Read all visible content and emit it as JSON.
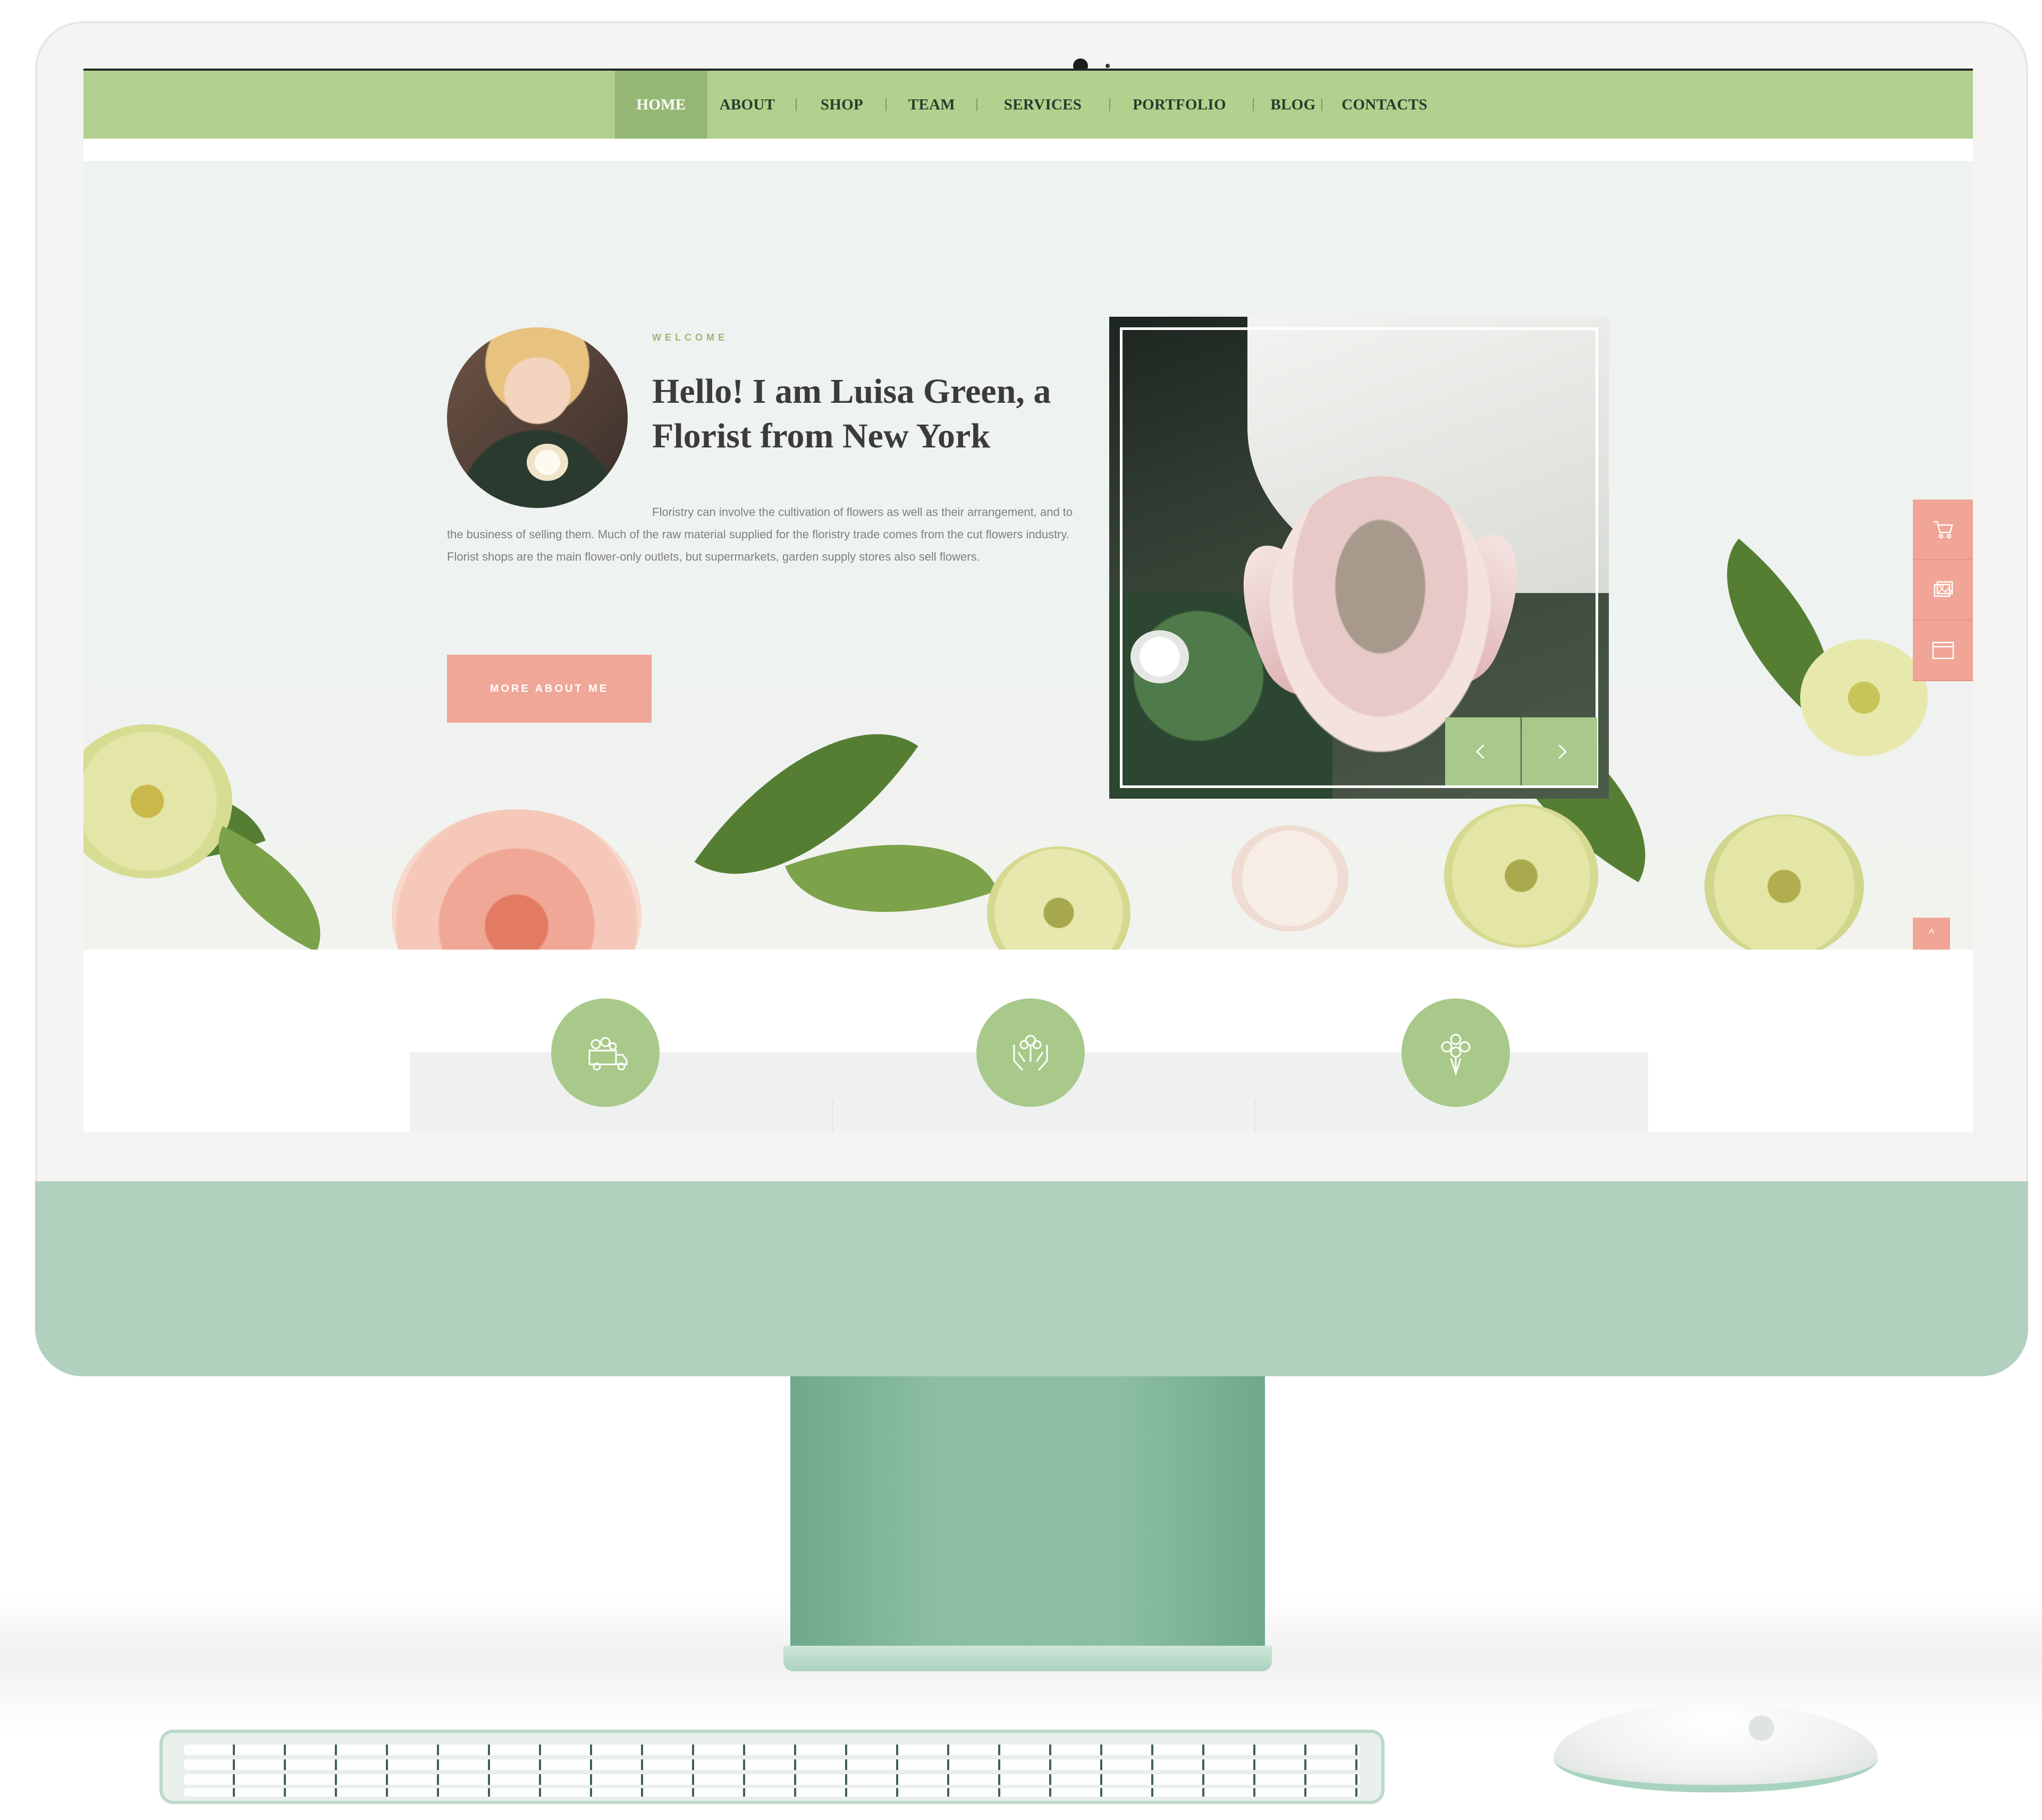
{
  "nav": {
    "items": [
      {
        "label": "HOME",
        "active": true
      },
      {
        "label": "ABOUT",
        "active": false
      },
      {
        "label": "SHOP",
        "active": false
      },
      {
        "label": "TEAM",
        "active": false
      },
      {
        "label": "SERVICES",
        "active": false
      },
      {
        "label": "PORTFOLIO",
        "active": false
      },
      {
        "label": "BLOG",
        "active": false
      },
      {
        "label": "CONTACTS",
        "active": false
      }
    ]
  },
  "hero": {
    "eyebrow": "WELCOME",
    "title": "Hello! I am Luisa Green, a Florist from New York",
    "body": "Floristry can involve the cultivation of flowers as well as their arrangement, and to the business of selling them. Much of the raw material supplied for the floristry trade comes from the cut flowers industry. Florist shops are the main flower-only outlets, but supermarkets, garden supply stores also sell flowers.",
    "cta_label": "MORE ABOUT ME"
  },
  "slider": {
    "prev_icon": "chevron-left-icon",
    "next_icon": "chevron-right-icon"
  },
  "side_tools": [
    "cart-icon",
    "gallery-icon",
    "browser-window-icon"
  ],
  "scroll_top_glyph": "^",
  "features": [
    "delivery-truck-icon",
    "hands-flower-icon",
    "bouquet-icon"
  ],
  "colors": {
    "nav_bg": "#b2d18e",
    "nav_active": "#95b774",
    "accent_pink": "#efa798",
    "accent_green": "#a8c98a",
    "monitor_chin": "#b1d0be"
  }
}
